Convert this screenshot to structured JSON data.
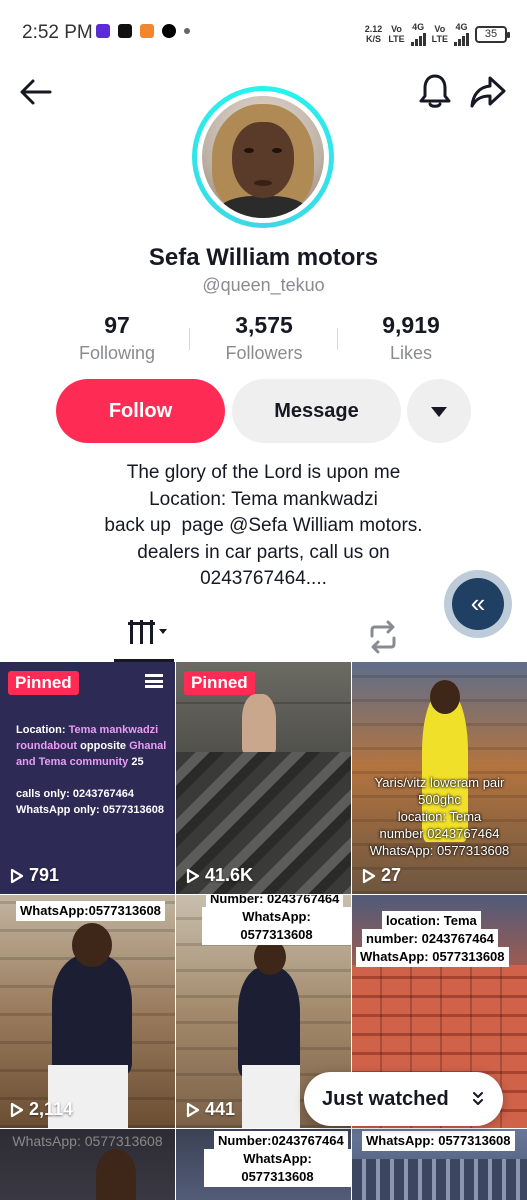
{
  "status_bar": {
    "time": "2:52 PM",
    "speed": "2.12",
    "speed_unit": "K/S",
    "net1_top": "Vo",
    "net1_bottom": "LTE",
    "net1_gen": "4G",
    "net2_top": "Vo",
    "net2_bottom": "LTE",
    "net2_gen": "4G",
    "battery": "35"
  },
  "profile": {
    "name": "Sefa William motors",
    "handle": "@queen_tekuo",
    "stats": [
      {
        "value": "97",
        "label": "Following"
      },
      {
        "value": "3,575",
        "label": "Followers"
      },
      {
        "value": "9,919",
        "label": "Likes"
      }
    ],
    "follow_label": "Follow",
    "message_label": "Message",
    "bio_lines": [
      "The glory of the Lord is upon me",
      "Location: Tema mankwadzi",
      "back up  page @Sefa William motors.",
      "dealers in car parts, call us on",
      "0243767464...."
    ]
  },
  "colors": {
    "accent": "#fe2c55",
    "avatar_ring": "#25f4ee",
    "float_button": "#1f3f63"
  },
  "float_button_glyph": "«",
  "videos": [
    {
      "pinned": "Pinned",
      "views": "791",
      "text_lines": [
        "Location: ",
        "Tema mankwadzi roundabout",
        " opposite ",
        "Ghanal and Tema community",
        " 25",
        "calls only:  0243767464",
        "WhatsApp only: 0577313608"
      ]
    },
    {
      "pinned": "Pinned",
      "views": "41.6K"
    },
    {
      "views": "27",
      "caption": [
        "Yaris/vitz loweram pair",
        "500ghc",
        "location: Tema",
        "number 0243767464",
        "WhatsApp: 0577313608"
      ]
    },
    {
      "views": "2,114",
      "caption_box": "WhatsApp:0577313608"
    },
    {
      "views": "441",
      "caption_box_top": "Number: 0243767464",
      "caption_box": "WhatsApp: 0577313608"
    },
    {
      "caption_box_lines": [
        "location: Tema",
        "number: 0243767464",
        "WhatsApp: 0577313608"
      ]
    },
    {
      "caption": [
        "WhatsApp: 0577313608"
      ]
    },
    {
      "caption_box_lines": [
        "Number:0243767464",
        "WhatsApp: 0577313608"
      ]
    },
    {
      "caption_box_lines": [
        "WhatsApp: 0577313608"
      ]
    }
  ],
  "just_watched_label": "Just watched"
}
